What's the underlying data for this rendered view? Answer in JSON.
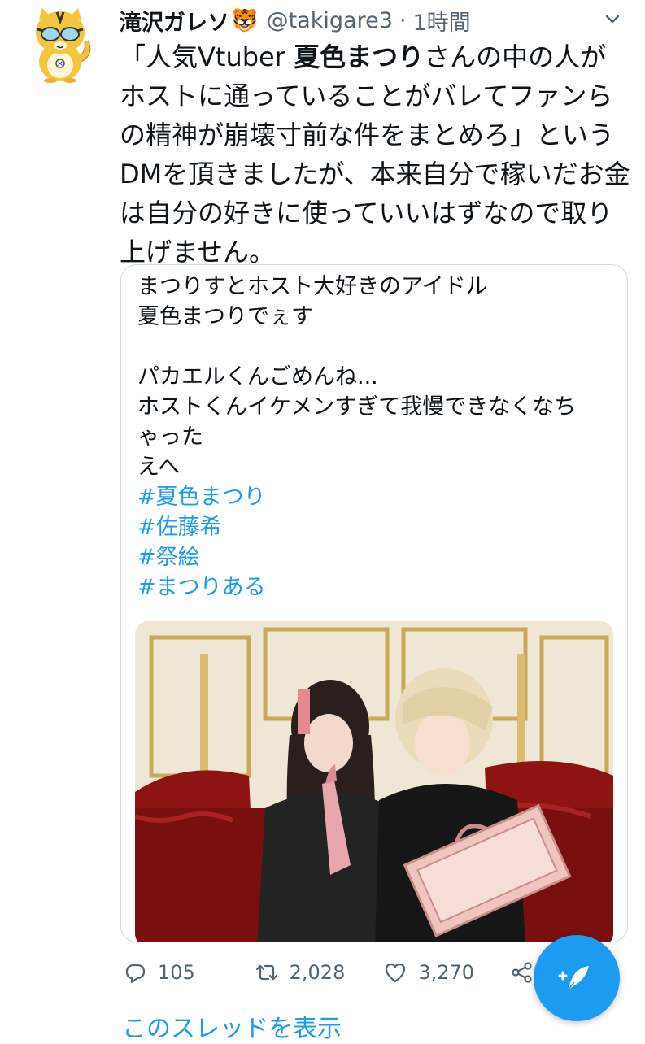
{
  "tweet": {
    "author_name": "滝沢ガレソ",
    "author_emoji": "🐯",
    "handle": "@takigare3",
    "separator": "·",
    "time": "1時間",
    "text_parts": [
      "「人気Vtuber ",
      "夏色まつり",
      "さんの中の人がホストに通っていることがバレてファンらの精神が崩壊寸前な件をまとめろ」というDMを頂きましたが、本来自分で稼いだお金は自分の好きに使っていいはずなので取り上げません。"
    ]
  },
  "quote": {
    "lines": [
      "まつりすとホスト大好きのアイドル",
      "夏色まつりでぇす",
      "",
      "パカエルくんごめんね...",
      "ホストくんイケメンすぎて我慢できなくなち",
      "ゃった",
      "えへ"
    ],
    "hashtags": [
      "#夏色まつり",
      "#佐藤希",
      "#祭絵",
      "#まつりある"
    ]
  },
  "actions": {
    "replies": "105",
    "retweets": "2,028",
    "likes": "3,270"
  },
  "thread_link": "このスレッドを表示",
  "colors": {
    "accent": "#1d9bf0",
    "text": "#0f1419",
    "muted": "#536471",
    "border": "#cfd9de"
  },
  "icons": [
    "caret-down-icon",
    "reply-icon",
    "retweet-icon",
    "like-icon",
    "share-icon",
    "compose-tweet-icon"
  ]
}
